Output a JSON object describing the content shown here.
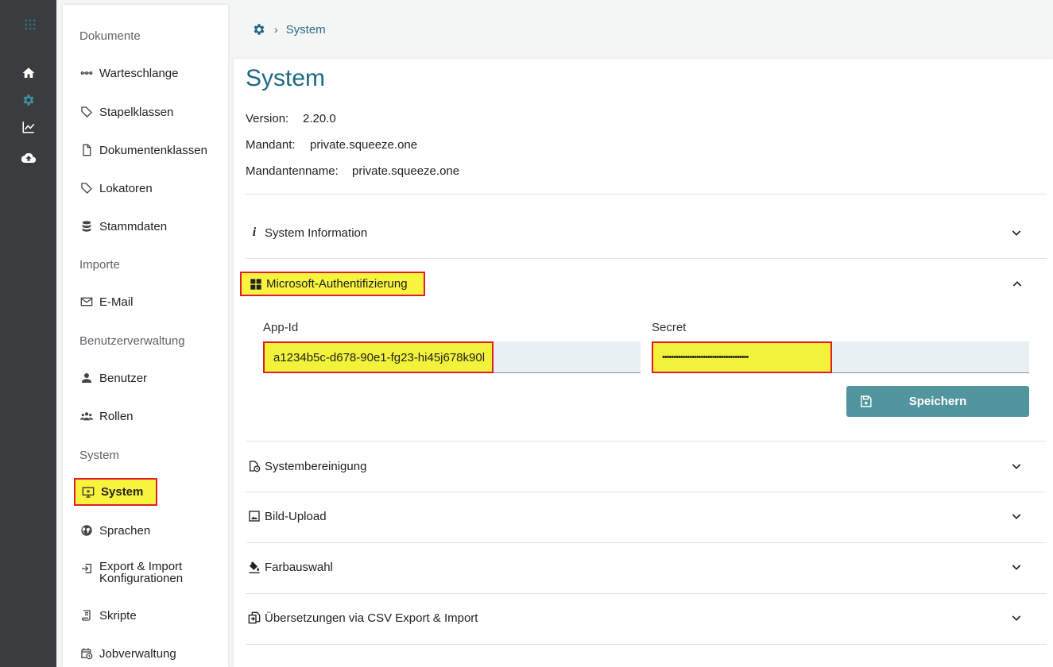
{
  "breadcrumb": {
    "current": "System"
  },
  "menu": {
    "sections": {
      "documents": "Dokumente",
      "imports": "Importe",
      "users": "Benutzerverwaltung",
      "system": "System"
    },
    "items": {
      "queue": "Warteschlange",
      "batch_classes": "Stapelklassen",
      "document_classes": "Dokumentenklassen",
      "locators": "Lokatoren",
      "master_data": "Stammdaten",
      "email": "E-Mail",
      "users": "Benutzer",
      "roles": "Rollen",
      "system": "System",
      "languages": "Sprachen",
      "export_import_1": "Export & Import",
      "export_import_2": "Konfigurationen",
      "scripts": "Skripte",
      "jobs": "Jobverwaltung"
    }
  },
  "page": {
    "title": "System",
    "version_label": "Version:",
    "version_value": "2.20.0",
    "tenant_label": "Mandant:",
    "tenant_value": "private.squeeze.one",
    "tenant_name_label": "Mandantenname:",
    "tenant_name_value": "private.squeeze.one"
  },
  "accordions": {
    "system_info": "System Information",
    "ms_auth": "Microsoft-Authentifizierung",
    "cleanup": "Systembereinigung",
    "image_upload": "Bild-Upload",
    "colors": "Farbauswahl",
    "translations": "Übersetzungen via CSV Export & Import"
  },
  "ms_auth_form": {
    "app_id_label": "App-Id",
    "app_id_value": "a1234b5c-d678-90e1-fg23-hi45j678k90l",
    "secret_label": "Secret",
    "secret_value": "••••••••••••••••••••••••••••••••••••••",
    "save_label": "Speichern"
  },
  "colors": {
    "accent": "#1e6a82",
    "rail": "#3b3c3d",
    "highlight": "#f8f33c",
    "highlight_border": "#e21d26",
    "button": "#51969f"
  }
}
